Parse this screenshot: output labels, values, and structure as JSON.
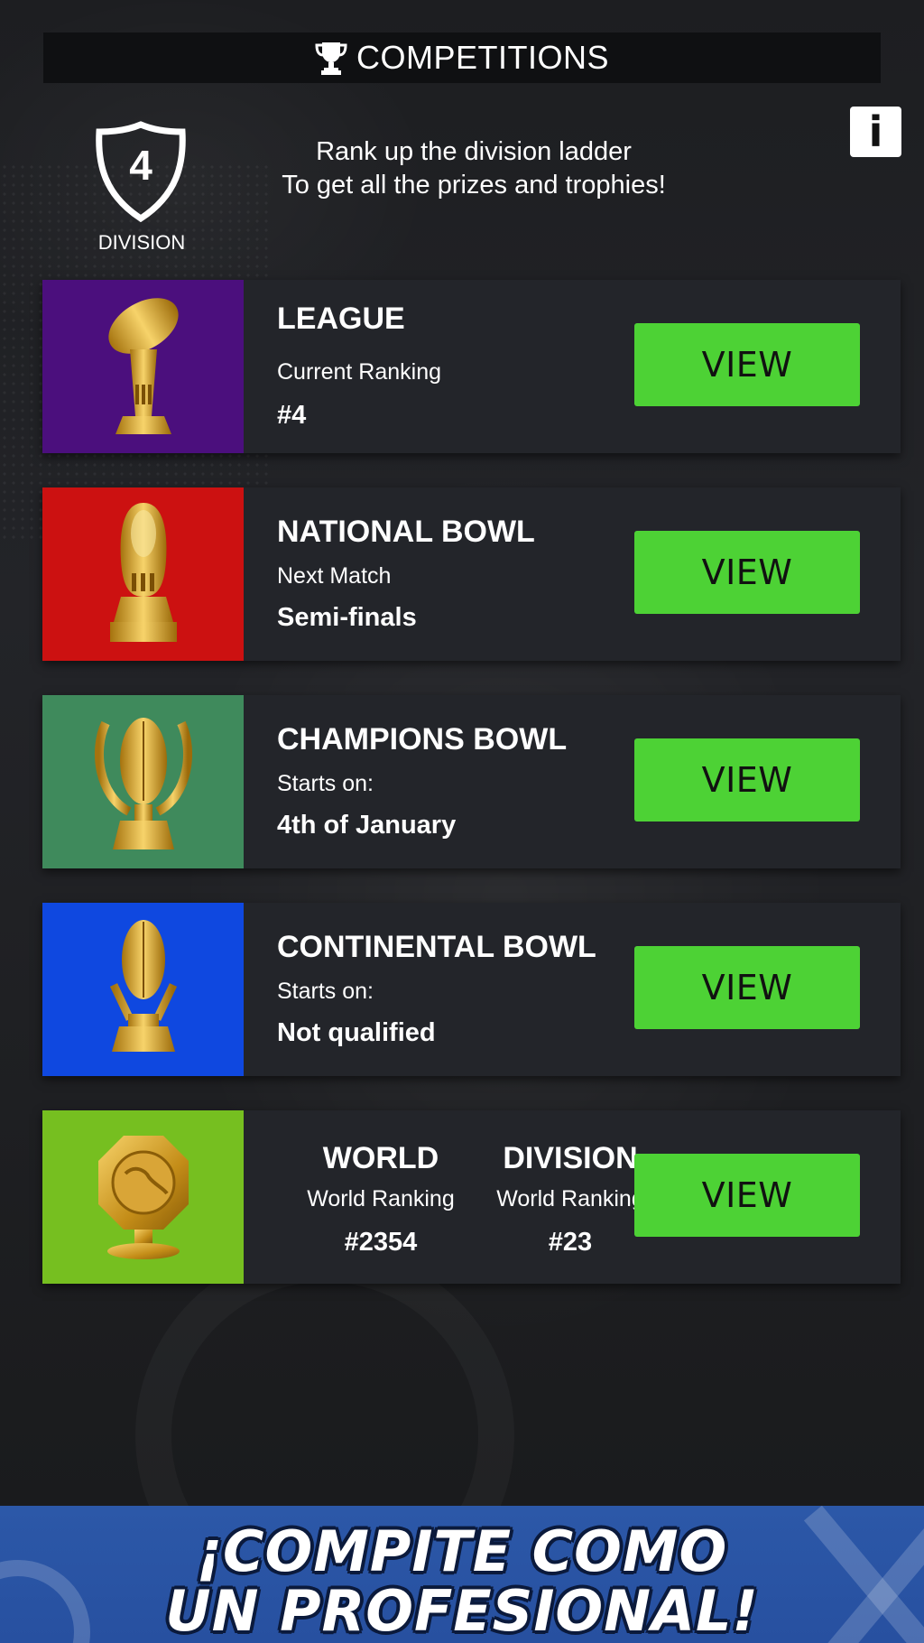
{
  "header": {
    "title": "COMPETITIONS",
    "info_label": "i"
  },
  "division": {
    "number": "4",
    "label": "DIVISION"
  },
  "tagline": {
    "line1": "Rank up the division ladder",
    "line2": "To get all the prizes and trophies!"
  },
  "cards": [
    {
      "name": "LEAGUE",
      "sub": "Current Ranking",
      "value": "#4",
      "button": "VIEW",
      "color": "#4b0f7d"
    },
    {
      "name": "NATIONAL BOWL",
      "sub": "Next Match",
      "value": "Semi-finals",
      "button": "VIEW",
      "color": "#cc1111"
    },
    {
      "name": "CHAMPIONS BOWL",
      "sub": "Starts on:",
      "value": "4th of January",
      "button": "VIEW",
      "color": "#3f8a5c"
    },
    {
      "name": "CONTINENTAL BOWL",
      "sub": "Starts on:",
      "value": "Not qualified",
      "button": "VIEW",
      "color": "#0f48e0"
    },
    {
      "button": "VIEW",
      "color": "#76bf20",
      "columns": [
        {
          "name": "WORLD",
          "sub": "World Ranking",
          "value": "#2354"
        },
        {
          "name": "DIVISION",
          "sub": "World Ranking",
          "value": "#23"
        }
      ]
    }
  ],
  "banner": {
    "line1": "¡COMPITE COMO",
    "line2": "UN PROFESIONAL!",
    "color": "#2c58a8"
  },
  "icons": [
    "trophy-icon",
    "info-icon",
    "shield-icon",
    "league-trophy-icon",
    "national-bowl-trophy-icon",
    "champions-bowl-trophy-icon",
    "continental-bowl-trophy-icon",
    "world-globe-trophy-icon"
  ]
}
